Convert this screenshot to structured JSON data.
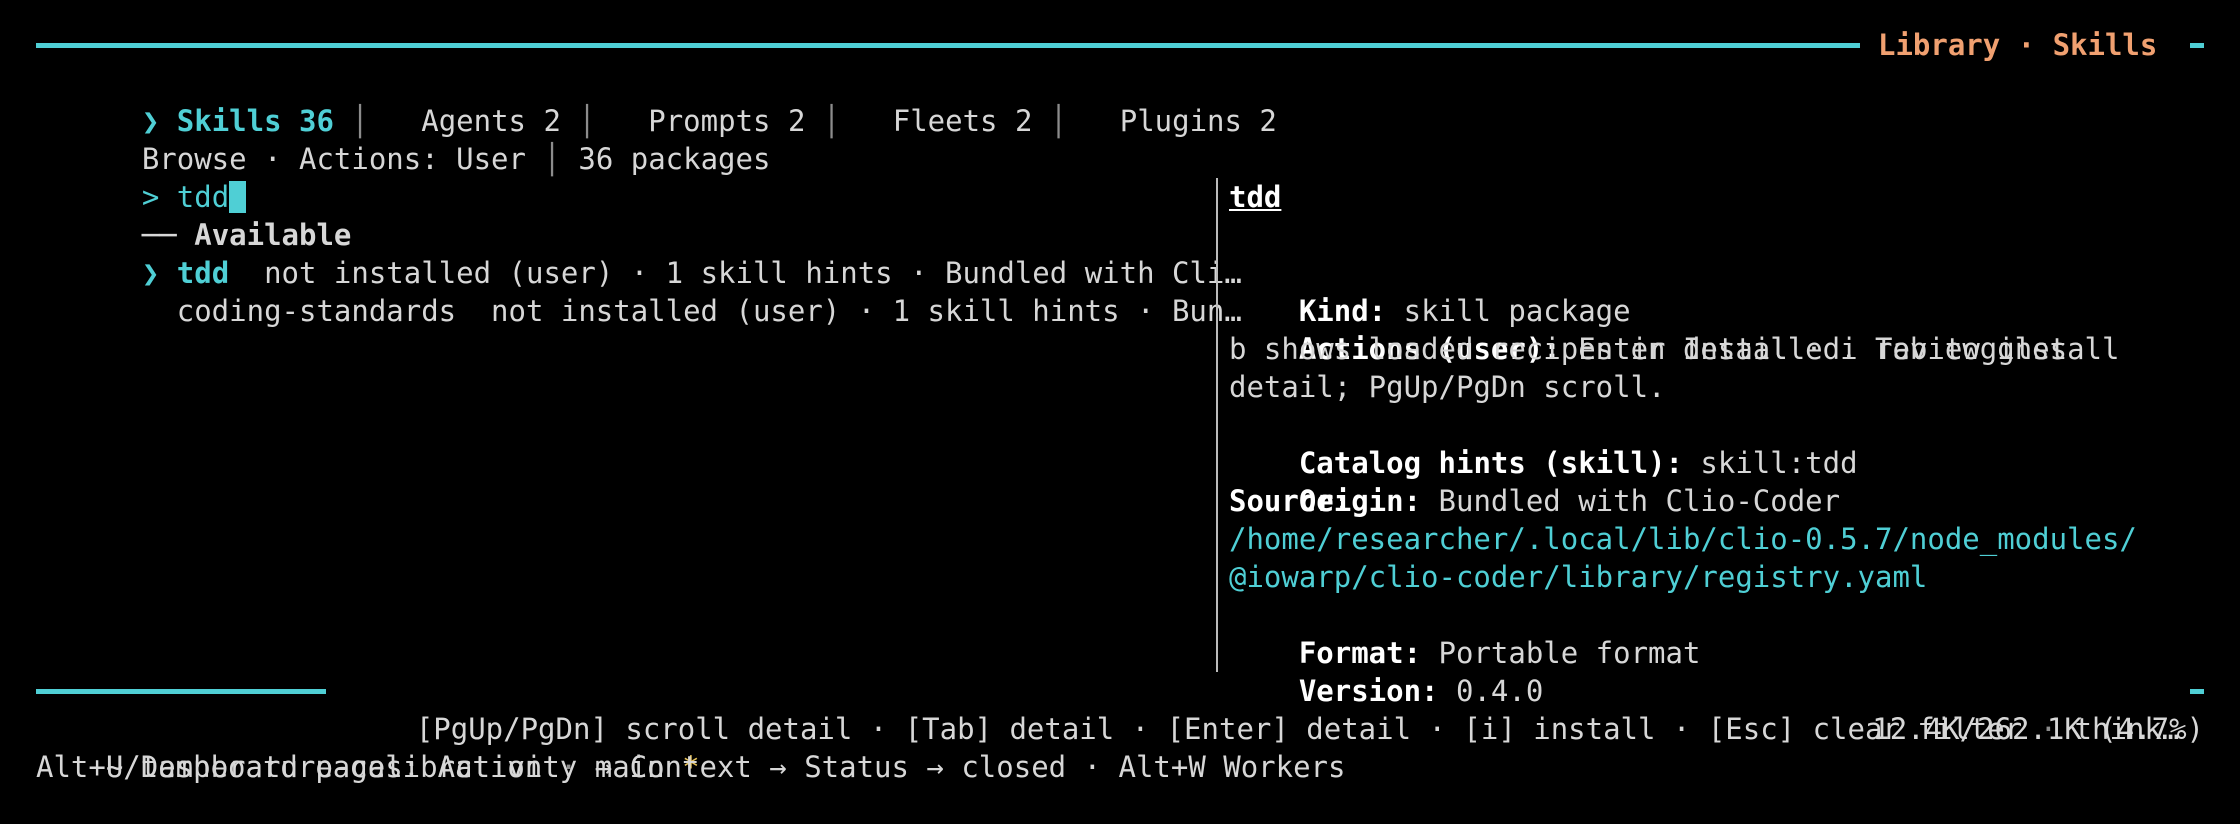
{
  "header": {
    "title": "Library · Skills"
  },
  "tabs": [
    {
      "marker": "❯",
      "label": "Skills 36",
      "active": true
    },
    {
      "label": "Agents 2"
    },
    {
      "label": "Prompts 2"
    },
    {
      "label": "Fleets 2"
    },
    {
      "label": "Plugins 2"
    }
  ],
  "browse": {
    "mode": "Browse · Actions: User",
    "count": "36 packages"
  },
  "filter": {
    "prompt": ">",
    "value": "tdd"
  },
  "list": {
    "section_label": "Available",
    "section_prefix": "──",
    "items": [
      {
        "marker": "❯",
        "name": "tdd",
        "desc": "not installed (user) · 1 skill hints · Bundled with Cli…",
        "selected": true
      },
      {
        "name": "coding-standards",
        "desc": "not installed (user) · 1 skill hints · Bun…"
      }
    ]
  },
  "detail": {
    "title": "tdd",
    "kind_label": "Kind:",
    "kind_value": "skill package",
    "actions_label": "Actions (user):",
    "actions_value": "Enter detail · i review install",
    "actions_line2": "b shows loaded recipes in Installed. Tab toggles",
    "actions_line3": "detail; PgUp/PgDn scroll.",
    "hints_label": "Catalog hints (skill):",
    "hints_value": "skill:tdd",
    "origin_label": "Origin:",
    "origin_value": "Bundled with Clio-Coder",
    "source_label": "Source:",
    "source_line1": "/home/researcher/.local/lib/clio-0.5.7/node_modules/",
    "source_line2": "@iowarp/clio-coder/library/registry.yaml",
    "format_label": "Format:",
    "format_value": "Portable format",
    "version_label": "Version:",
    "version_value": "0.4.0"
  },
  "footer": {
    "keys_a": "[PgUp/PgDn] scroll detail · [Tab] detail · [Enter] detail · [i] install · [Esc] clear filter",
    "keys_dot": "·",
    "keys_b": "think…",
    "path": "~/temperature-calibration",
    "dot": "·",
    "branch": "main",
    "dirty": "*",
    "context": "12.4K/262.1K (4.7%)",
    "hint": "Alt+U Dashboard pages: Activity → Context → Status → closed · Alt+W Workers"
  },
  "colors": {
    "accent": "#4fcfd5",
    "title": "#f0a070",
    "dirty": "#e8c35a",
    "background": "#000000"
  }
}
